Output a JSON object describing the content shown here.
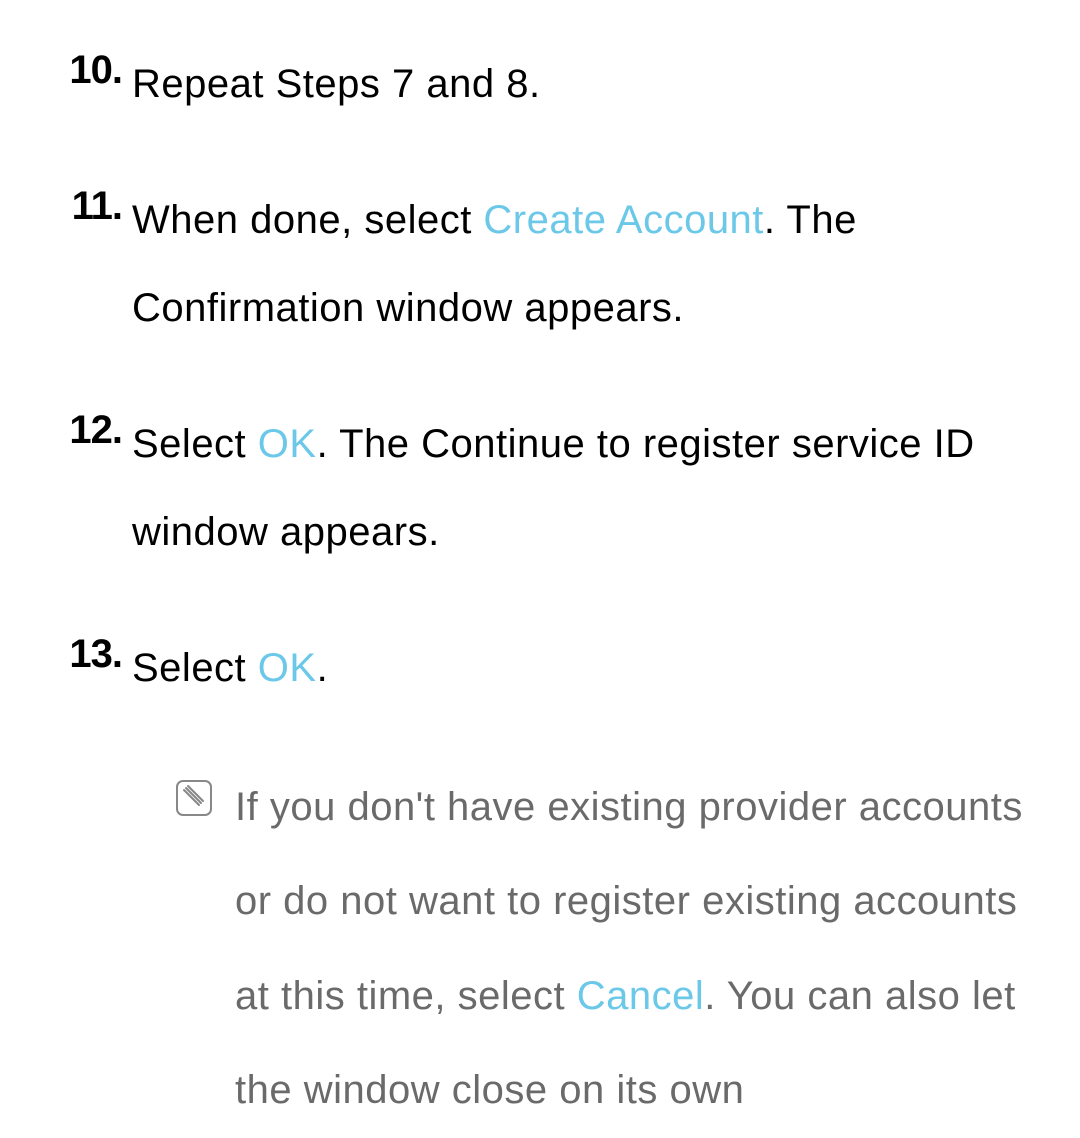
{
  "steps": [
    {
      "number": "10.",
      "text": "Repeat Steps 7 and 8."
    },
    {
      "number": "11.",
      "pre": "When done, select ",
      "highlight": "Create Account",
      "post": ". The Confirmation window appears."
    },
    {
      "number": "12.",
      "pre": "Select ",
      "highlight": "OK",
      "post": ". The Continue to register service ID window appears."
    },
    {
      "number": "13.",
      "pre": "Select ",
      "highlight": "OK",
      "post": "."
    }
  ],
  "note": {
    "pre": "If you don't have existing provider accounts or do not want to register existing accounts at this time, select ",
    "highlight": "Cancel",
    "post": ". You can also let the window close on its own"
  }
}
